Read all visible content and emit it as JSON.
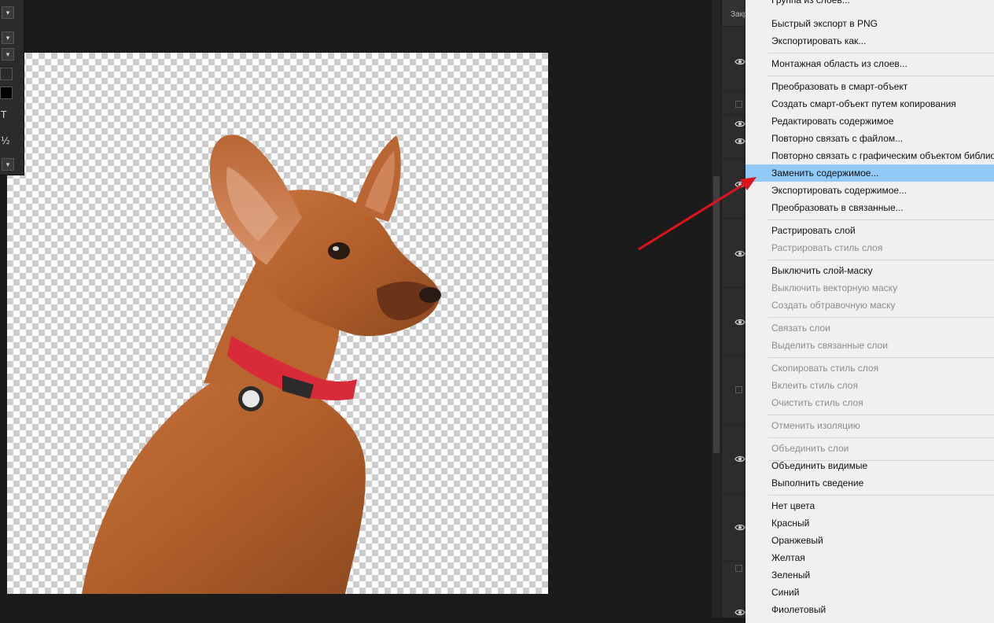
{
  "layers_panel": {
    "tab_label": "Закр"
  },
  "context_menu": {
    "items": [
      {
        "label": "Группа из слоев...",
        "disabled": false
      },
      {
        "label": "Быстрый экспорт в PNG",
        "disabled": false
      },
      {
        "label": "Экспортировать как...",
        "disabled": false
      },
      {
        "label": "Монтажная область из слоев...",
        "disabled": false
      },
      {
        "label": "Преобразовать в смарт-объект",
        "disabled": false
      },
      {
        "label": "Создать смарт-объект путем копирования",
        "disabled": false
      },
      {
        "label": "Редактировать содержимое",
        "disabled": false
      },
      {
        "label": "Повторно связать с файлом...",
        "disabled": false
      },
      {
        "label": "Повторно связать с графическим объектом библиотеки...",
        "disabled": false
      },
      {
        "label": "Заменить содержимое...",
        "disabled": false,
        "highlighted": true
      },
      {
        "label": "Экспортировать содержимое...",
        "disabled": false
      },
      {
        "label": "Преобразовать в связанные...",
        "disabled": false
      },
      {
        "label": "Растрировать слой",
        "disabled": false
      },
      {
        "label": "Растрировать стиль слоя",
        "disabled": true
      },
      {
        "label": "Выключить слой-маску",
        "disabled": false
      },
      {
        "label": "Выключить векторную маску",
        "disabled": true
      },
      {
        "label": "Создать обтравочную маску",
        "disabled": true
      },
      {
        "label": "Связать слои",
        "disabled": true
      },
      {
        "label": "Выделить связанные слои",
        "disabled": true
      },
      {
        "label": "Скопировать стиль слоя",
        "disabled": true
      },
      {
        "label": "Вклеить стиль слоя",
        "disabled": true
      },
      {
        "label": "Очистить стиль слоя",
        "disabled": true
      },
      {
        "label": "Отменить изоляцию",
        "disabled": true
      },
      {
        "label": "Объединить слои",
        "disabled": true
      },
      {
        "label": "Объединить видимые",
        "disabled": false
      },
      {
        "label": "Выполнить сведение",
        "disabled": false
      },
      {
        "label": "Нет цвета",
        "disabled": false
      },
      {
        "label": "Красный",
        "disabled": false
      },
      {
        "label": "Оранжевый",
        "disabled": false
      },
      {
        "label": "Желтая",
        "disabled": false
      },
      {
        "label": "Зеленый",
        "disabled": false
      },
      {
        "label": "Синий",
        "disabled": false
      },
      {
        "label": "Фиолетовый",
        "disabled": false
      }
    ]
  },
  "options_strip": {
    "glyph_type": "T",
    "glyph_fraction": "½"
  },
  "colors": {
    "menu_background": "#f0f0f0",
    "menu_highlight": "#91c9f7",
    "menu_text": "#111111",
    "menu_disabled_text": "#8c8c8c",
    "annotation_arrow": "#e0121b",
    "workspace_background": "#1b1b1b"
  }
}
